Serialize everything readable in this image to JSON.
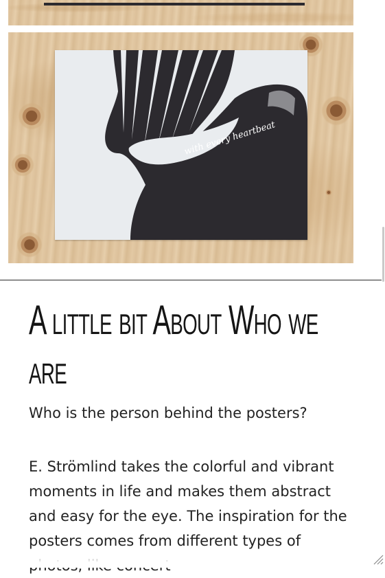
{
  "images": {
    "top_photo": {
      "icon": "wood-photo"
    },
    "poster_photo": {
      "icon": "poster-photo",
      "script_text": "with every heartbeat"
    }
  },
  "about": {
    "heading": "A little bit About Who we are",
    "question": "Who is the person behind the posters?",
    "paragraph": "E. Strömlind takes the colorful and vibrant moments in life and makes them abstract and easy for the eye. The inspiration for the posters comes from different types of photos, like concert"
  },
  "colors": {
    "wood": "#e2c8a3",
    "poster_bg": "#e9ecef",
    "ink": "#2c2a2f",
    "text": "#222222"
  }
}
